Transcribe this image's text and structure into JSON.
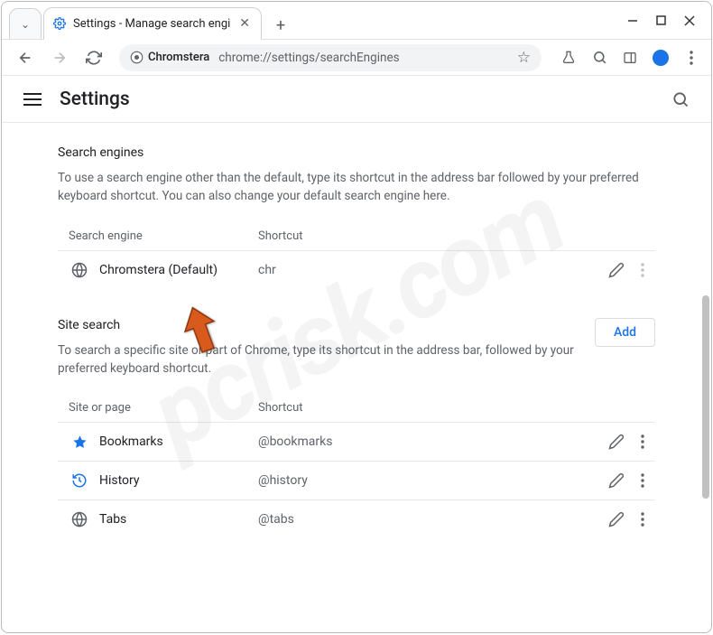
{
  "window": {
    "tab_title": "Settings - Manage search engi"
  },
  "toolbar": {
    "chip_label": "Chromstera",
    "url": "chrome://settings/searchEngines"
  },
  "header": {
    "title": "Settings"
  },
  "search_engines": {
    "title": "Search engines",
    "description": "To use a search engine other than the default, type its shortcut in the address bar followed by your preferred keyboard shortcut. You can also change your default search engine here.",
    "col_engine": "Search engine",
    "col_shortcut": "Shortcut",
    "rows": [
      {
        "name": "Chromstera (Default)",
        "shortcut": "chr"
      }
    ]
  },
  "site_search": {
    "title": "Site search",
    "description": "To search a specific site or part of Chrome, type its shortcut in the address bar, followed by your preferred keyboard shortcut.",
    "add_label": "Add",
    "col_site": "Site or page",
    "col_shortcut": "Shortcut",
    "rows": [
      {
        "name": "Bookmarks",
        "shortcut": "@bookmarks",
        "icon": "star"
      },
      {
        "name": "History",
        "shortcut": "@history",
        "icon": "history"
      },
      {
        "name": "Tabs",
        "shortcut": "@tabs",
        "icon": "globe"
      }
    ]
  },
  "watermark": "pcrisk.com"
}
